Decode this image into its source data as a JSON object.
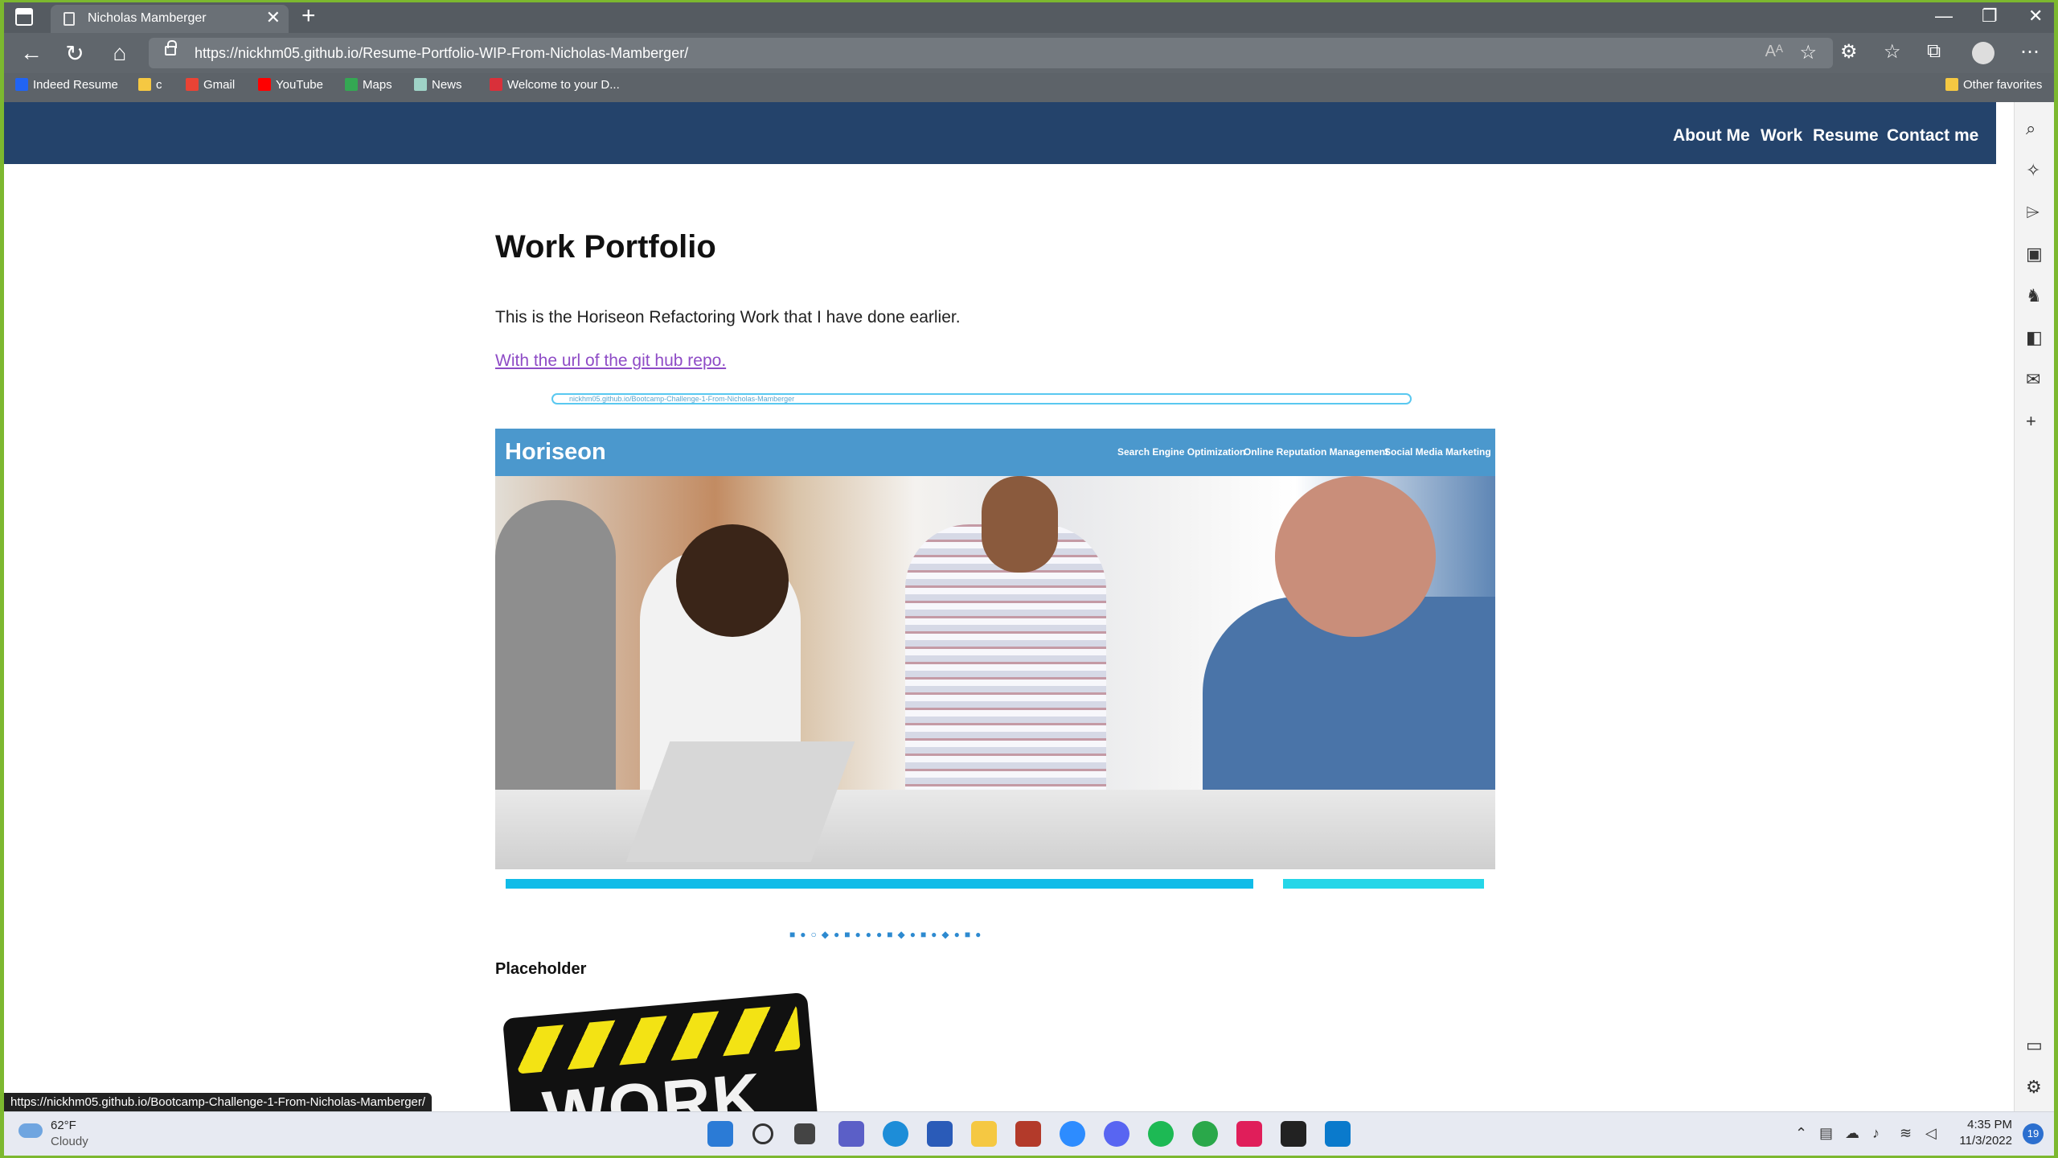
{
  "browser": {
    "tab_title": "Nicholas Mamberger",
    "tab_close": "✕",
    "new_tab": "+",
    "url": "https://nickhm05.github.io/Resume-Portfolio-WIP-From-Nicholas-Mamberger/",
    "read_aloud": "Aᴬ",
    "bookmarks": [
      "Indeed Resume",
      "c",
      "Gmail",
      "YouTube",
      "Maps",
      "News",
      "Welcome to your D...",
      "Other favorites"
    ],
    "status_url": "https://nickhm05.github.io/Bootcamp-Challenge-1-From-Nicholas-Mamberger/"
  },
  "site": {
    "nav": [
      "About Me",
      "Work",
      "Resume",
      "Contact me"
    ],
    "heading": "Work Portfolio",
    "intro": "This is the Horiseon Refactoring Work that I have done earlier.",
    "repo_link": "With the url of the git hub repo.",
    "placeholder": "Placeholder",
    "work_sign": "WORK"
  },
  "embedded_screenshot": {
    "mini_url": "nickhm05.github.io/Bootcamp-Challenge-1-From-Nicholas-Mamberger",
    "logo": "Horiseon",
    "menu": [
      "Search Engine Optimization",
      "Online Reputation Management",
      "Social Media Marketing"
    ]
  },
  "taskbar": {
    "temperature": "62°F",
    "condition": "Cloudy",
    "time": "4:35 PM",
    "date": "11/3/2022",
    "notifications": "19"
  },
  "colors": {
    "site_nav": "#24436b",
    "link_visited": "#8e4bc6",
    "horiseon_header": "#4b98cd",
    "window_border": "#7cb82f"
  }
}
